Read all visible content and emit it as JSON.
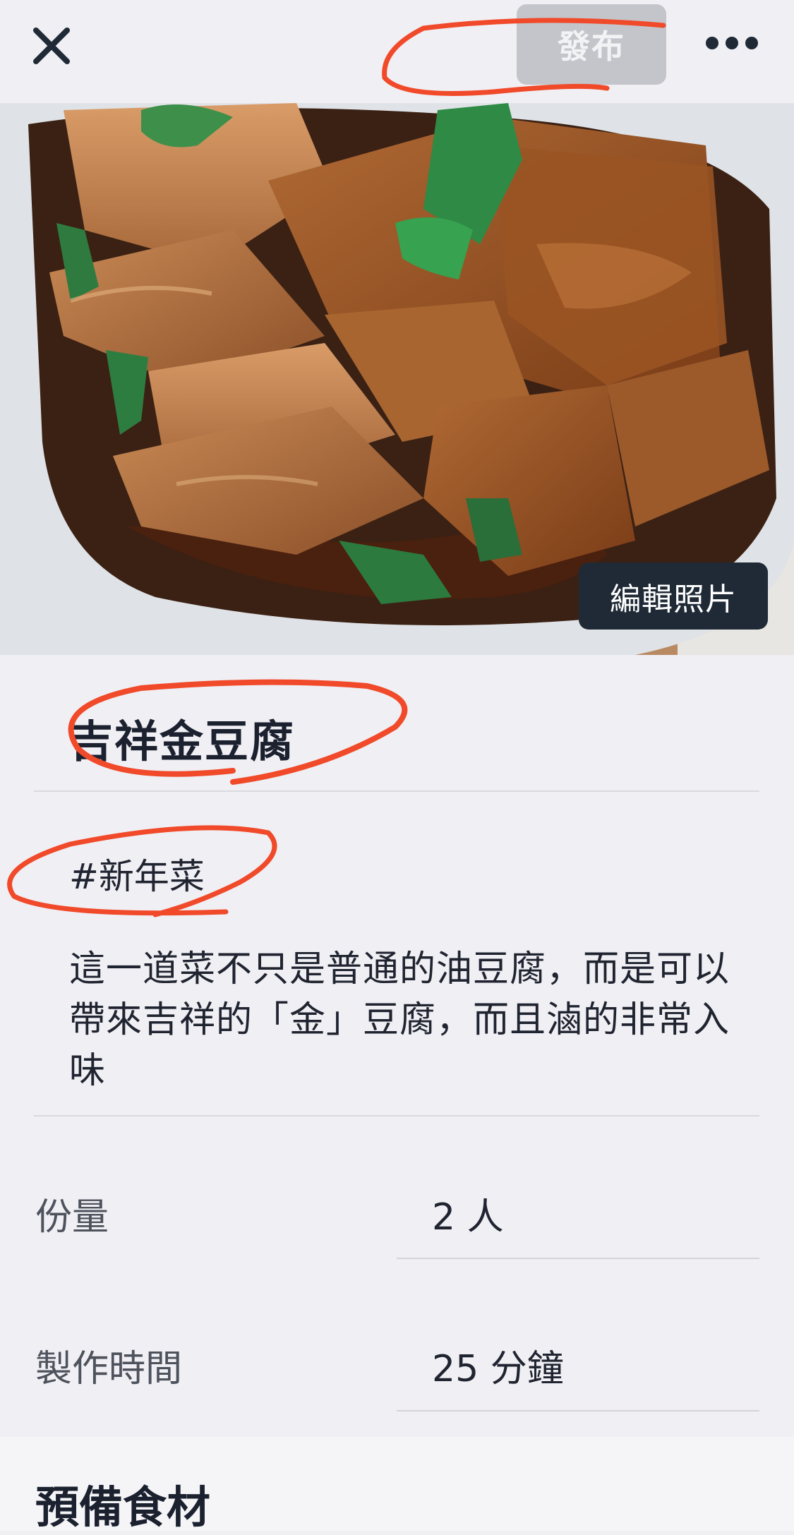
{
  "header": {
    "close_icon": "close-icon",
    "publish_label": "發布",
    "more_icon": "more-horizontal-icon"
  },
  "hero": {
    "image_description_icon": "tofu-dish-photo",
    "edit_photo_label": "編輯照片"
  },
  "recipe": {
    "title": "吉祥金豆腐",
    "hashtag": "#新年菜",
    "description": "這一道菜不只是普通的油豆腐，而是可以帶來吉祥的「金」豆腐，而且滷的非常入味"
  },
  "details": [
    {
      "label": "份量",
      "value": "2 人"
    },
    {
      "label": "製作時間",
      "value": "25 分鐘"
    }
  ],
  "sections": {
    "ingredients_title": "預備食材"
  },
  "colors": {
    "background": "#f0eff4",
    "publish_disabled": "#c3c5ca",
    "edit_button": "#1f2a36",
    "annotation_red": "#f04a2a"
  }
}
